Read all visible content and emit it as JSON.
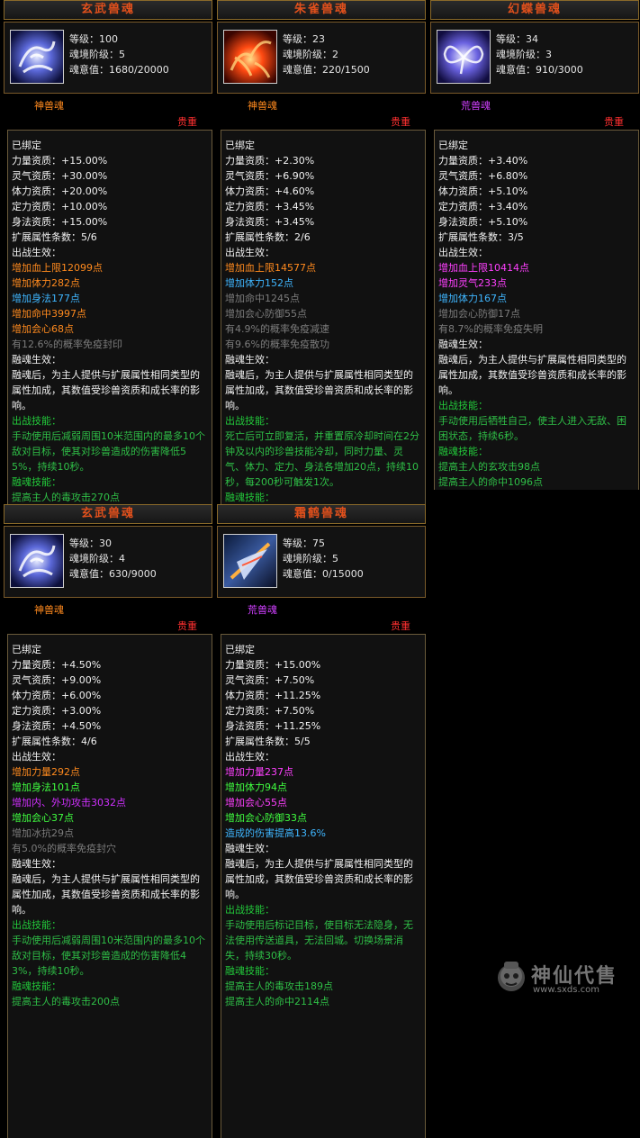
{
  "cards": [
    {
      "title": "玄武兽魂",
      "level": "等级：100",
      "tier": "魂境阶级：5",
      "will": "魂意值：1680/20000",
      "type": "神兽魂",
      "rarity": "贵重",
      "icon": "xuanwu-soul-icon",
      "lines": [
        {
          "text": "已绑定",
          "color": "c-w"
        },
        {
          "text": "力量资质：+15.00%",
          "color": "c-w"
        },
        {
          "text": "灵气资质：+30.00%",
          "color": "c-w"
        },
        {
          "text": "体力资质：+20.00%",
          "color": "c-w"
        },
        {
          "text": "定力资质：+10.00%",
          "color": "c-w"
        },
        {
          "text": "身法资质：+15.00%",
          "color": "c-w"
        },
        {
          "text": "扩展属性条数：5/6",
          "color": "c-w"
        },
        {
          "text": "出战生效：",
          "color": "c-w"
        },
        {
          "text": "增加血上限12099点",
          "color": "c-o"
        },
        {
          "text": "增加体力282点",
          "color": "c-o"
        },
        {
          "text": "增加身法177点",
          "color": "c-b"
        },
        {
          "text": "增加命中3997点",
          "color": "c-o"
        },
        {
          "text": "增加会心68点",
          "color": "c-o"
        },
        {
          "text": "有12.6%的概率免疫封印",
          "color": "c-gy"
        },
        {
          "text": "融魂生效：",
          "color": "c-w"
        },
        {
          "text": "融魂后，为主人提供与扩展属性相同类型的属性加成，其数值受珍兽资质和成长率的影响。",
          "color": "c-w",
          "wrap": true
        },
        {
          "text": "出战技能：",
          "color": "c-g"
        },
        {
          "text": "手动使用后减弱周围10米范围内的最多10个敌对目标，使其对珍兽造成的伤害降低55%，持续10秒。",
          "color": "c-gw",
          "wrap": true
        },
        {
          "text": "融魂技能：",
          "color": "c-g"
        },
        {
          "text": "提高主人的毒攻击270点",
          "color": "c-gw"
        }
      ]
    },
    {
      "title": "朱雀兽魂",
      "level": "等级：23",
      "tier": "魂境阶级：2",
      "will": "魂意值：220/1500",
      "type": "神兽魂",
      "rarity": "贵重",
      "icon": "zhuque-soul-icon",
      "lines": [
        {
          "text": "已绑定",
          "color": "c-w"
        },
        {
          "text": "力量资质：+2.30%",
          "color": "c-w"
        },
        {
          "text": "灵气资质：+6.90%",
          "color": "c-w"
        },
        {
          "text": "体力资质：+4.60%",
          "color": "c-w"
        },
        {
          "text": "定力资质：+3.45%",
          "color": "c-w"
        },
        {
          "text": "身法资质：+3.45%",
          "color": "c-w"
        },
        {
          "text": "扩展属性条数：2/6",
          "color": "c-w"
        },
        {
          "text": "出战生效：",
          "color": "c-w"
        },
        {
          "text": "增加血上限14577点",
          "color": "c-o"
        },
        {
          "text": "增加体力152点",
          "color": "c-b"
        },
        {
          "text": "增加命中1245点",
          "color": "c-gy"
        },
        {
          "text": "增加会心防御55点",
          "color": "c-gy"
        },
        {
          "text": "有4.9%的概率免疫减速",
          "color": "c-gy"
        },
        {
          "text": "有9.6%的概率免疫散功",
          "color": "c-gy"
        },
        {
          "text": "融魂生效：",
          "color": "c-w"
        },
        {
          "text": "融魂后，为主人提供与扩展属性相同类型的属性加成，其数值受珍兽资质和成长率的影响。",
          "color": "c-w",
          "wrap": true
        },
        {
          "text": "出战技能：",
          "color": "c-g"
        },
        {
          "text": "死亡后可立即复活，并重置原冷却时间在2分钟及以内的珍兽技能冷却，同时力量、灵气、体力、定力、身法各增加20点，持续10秒，每200秒可触发1次。",
          "color": "c-gw",
          "wrap": true
        },
        {
          "text": "融魂技能：",
          "color": "c-g"
        }
      ]
    },
    {
      "title": "幻蝶兽魂",
      "level": "等级：34",
      "tier": "魂境阶级：3",
      "will": "魂意值：910/3000",
      "type": "荒兽魂",
      "rarity": "贵重",
      "icon": "huandie-soul-icon",
      "lines": [
        {
          "text": "已绑定",
          "color": "c-w"
        },
        {
          "text": "力量资质：+3.40%",
          "color": "c-w"
        },
        {
          "text": "灵气资质：+6.80%",
          "color": "c-w"
        },
        {
          "text": "体力资质：+5.10%",
          "color": "c-w"
        },
        {
          "text": "定力资质：+3.40%",
          "color": "c-w"
        },
        {
          "text": "身法资质：+5.10%",
          "color": "c-w"
        },
        {
          "text": "扩展属性条数：3/5",
          "color": "c-w"
        },
        {
          "text": "出战生效：",
          "color": "c-w"
        },
        {
          "text": "增加血上限10414点",
          "color": "c-p"
        },
        {
          "text": "增加灵气233点",
          "color": "c-p"
        },
        {
          "text": "增加体力167点",
          "color": "c-b"
        },
        {
          "text": "增加会心防御17点",
          "color": "c-gy"
        },
        {
          "text": "有8.7%的概率免疫失明",
          "color": "c-gy"
        },
        {
          "text": "融魂生效：",
          "color": "c-w"
        },
        {
          "text": "融魂后，为主人提供与扩展属性相同类型的属性加成，其数值受珍兽资质和成长率的影响。",
          "color": "c-w",
          "wrap": true
        },
        {
          "text": "出战技能：",
          "color": "c-g"
        },
        {
          "text": "手动使用后牺牲自己，使主人进入无敌、困困状态，持续6秒。",
          "color": "c-gw",
          "wrap": true
        },
        {
          "text": "融魂技能：",
          "color": "c-g"
        },
        {
          "text": "提高主人的玄攻击98点",
          "color": "c-gw"
        },
        {
          "text": "提高主人的命中1096点",
          "color": "c-gw"
        }
      ]
    },
    {
      "title": "玄武兽魂",
      "level": "等级：30",
      "tier": "魂境阶级：4",
      "will": "魂意值：630/9000",
      "type": "神兽魂",
      "rarity": "贵重",
      "icon": "xuanwu-soul-icon",
      "lines": [
        {
          "text": "已绑定",
          "color": "c-w"
        },
        {
          "text": "力量资质：+4.50%",
          "color": "c-w"
        },
        {
          "text": "灵气资质：+9.00%",
          "color": "c-w"
        },
        {
          "text": "体力资质：+6.00%",
          "color": "c-w"
        },
        {
          "text": "定力资质：+3.00%",
          "color": "c-w"
        },
        {
          "text": "身法资质：+4.50%",
          "color": "c-w"
        },
        {
          "text": "扩展属性条数：4/6",
          "color": "c-w"
        },
        {
          "text": "出战生效：",
          "color": "c-w"
        },
        {
          "text": "增加力量292点",
          "color": "c-o"
        },
        {
          "text": "增加身法101点",
          "color": "c-brt"
        },
        {
          "text": "增加内、外功攻击3032点",
          "color": "c-mag"
        },
        {
          "text": "增加会心37点",
          "color": "c-brt"
        },
        {
          "text": "增加冰抗29点",
          "color": "c-gy"
        },
        {
          "text": "有5.0%的概率免疫封穴",
          "color": "c-gy"
        },
        {
          "text": "融魂生效：",
          "color": "c-w"
        },
        {
          "text": "融魂后，为主人提供与扩展属性相同类型的属性加成，其数值受珍兽资质和成长率的影响。",
          "color": "c-w",
          "wrap": true
        },
        {
          "text": "出战技能：",
          "color": "c-g"
        },
        {
          "text": "手动使用后减弱周围10米范围内的最多10个敌对目标，使其对珍兽造成的伤害降低43%，持续10秒。",
          "color": "c-gw",
          "wrap": true
        },
        {
          "text": "融魂技能：",
          "color": "c-g"
        },
        {
          "text": "提高主人的毒攻击200点",
          "color": "c-gw"
        }
      ]
    },
    {
      "title": "霜鹤兽魂",
      "level": "等级：75",
      "tier": "魂境阶级：5",
      "will": "魂意值：0/15000",
      "type": "荒兽魂",
      "rarity": "贵重",
      "icon": "shuanghe-soul-icon",
      "lines": [
        {
          "text": "已绑定",
          "color": "c-w"
        },
        {
          "text": "力量资质：+15.00%",
          "color": "c-w"
        },
        {
          "text": "灵气资质：+7.50%",
          "color": "c-w"
        },
        {
          "text": "体力资质：+11.25%",
          "color": "c-w"
        },
        {
          "text": "定力资质：+7.50%",
          "color": "c-w"
        },
        {
          "text": "身法资质：+11.25%",
          "color": "c-w"
        },
        {
          "text": "扩展属性条数：5/5",
          "color": "c-w"
        },
        {
          "text": "出战生效：",
          "color": "c-w"
        },
        {
          "text": "增加力量237点",
          "color": "c-p"
        },
        {
          "text": "增加体力94点",
          "color": "c-brt"
        },
        {
          "text": "增加会心55点",
          "color": "c-p"
        },
        {
          "text": "增加会心防御33点",
          "color": "c-brt"
        },
        {
          "text": "造成的伤害提高13.6%",
          "color": "c-b"
        },
        {
          "text": "融魂生效：",
          "color": "c-w"
        },
        {
          "text": "融魂后，为主人提供与扩展属性相同类型的属性加成，其数值受珍兽资质和成长率的影响。",
          "color": "c-w",
          "wrap": true
        },
        {
          "text": "出战技能：",
          "color": "c-g"
        },
        {
          "text": "手动使用后标记目标，使目标无法隐身，无法使用传送道具，无法回城。切换场景消失，持续30秒。",
          "color": "c-gw",
          "wrap": true
        },
        {
          "text": "融魂技能：",
          "color": "c-g"
        },
        {
          "text": "提高主人的毒攻击189点",
          "color": "c-gw"
        },
        {
          "text": "提高主人的命中2114点",
          "color": "c-gw"
        }
      ]
    }
  ],
  "type_colors": {
    "神兽魂": "#ff8a1e",
    "荒兽魂": "#d040ff"
  },
  "watermark": {
    "name": "神仙代售",
    "url": "www.sxds.com"
  }
}
